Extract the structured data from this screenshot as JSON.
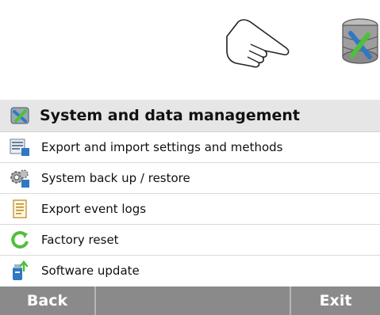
{
  "header": {
    "title": "System and data management",
    "icon": "tools-gear-icon"
  },
  "items": [
    {
      "label": "Export and import settings and methods",
      "icon": "export-import-icon"
    },
    {
      "label": "System back up / restore",
      "icon": "gears-backup-icon"
    },
    {
      "label": "Export event logs",
      "icon": "document-log-icon"
    },
    {
      "label": "Factory reset",
      "icon": "reset-arrow-icon"
    },
    {
      "label": "Software update",
      "icon": "usb-update-icon"
    }
  ],
  "footer": {
    "back_label": "Back",
    "exit_label": "Exit"
  },
  "colors": {
    "header_bg": "#e6e6e6",
    "footer_bg": "#8a8a8a",
    "accent_blue": "#2f78c4",
    "accent_green": "#4fbf3a"
  }
}
